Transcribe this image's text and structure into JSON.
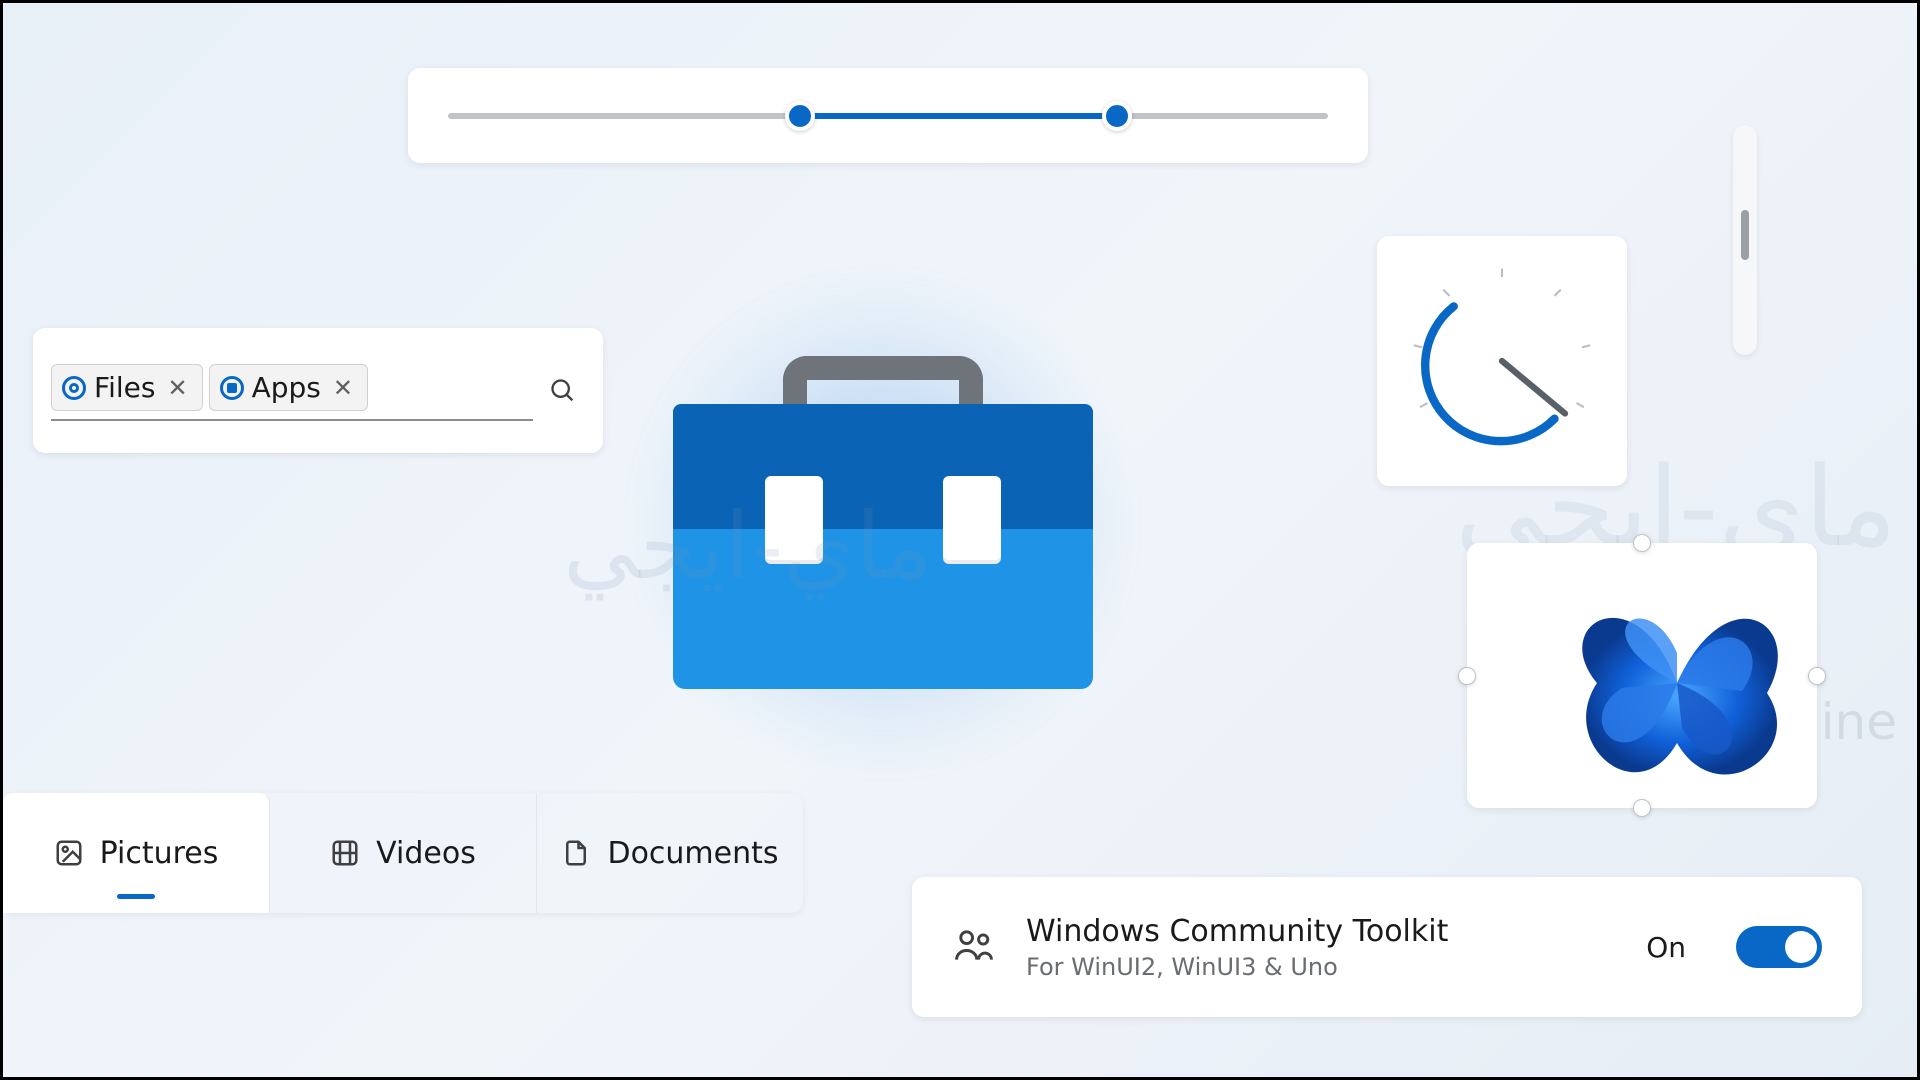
{
  "slider": {
    "low_pct": 40,
    "high_pct": 76
  },
  "filter": {
    "chips": [
      {
        "label": "Files",
        "icon": "radio"
      },
      {
        "label": "Apps",
        "icon": "square"
      }
    ]
  },
  "tabs": {
    "items": [
      {
        "label": "Pictures",
        "icon": "image",
        "active": true
      },
      {
        "label": "Videos",
        "icon": "video",
        "active": false
      },
      {
        "label": "Documents",
        "icon": "document",
        "active": false
      }
    ]
  },
  "toggle_card": {
    "title": "Windows Community Toolkit",
    "subtitle": "For WinUI2, WinUI3 & Uno",
    "state_label": "On",
    "on": true
  },
  "gauge": {
    "value_pct": 62
  },
  "watermark": {
    "arabic": "ماي-ايجي",
    "online": "nline"
  },
  "colors": {
    "accent": "#0968c6"
  }
}
